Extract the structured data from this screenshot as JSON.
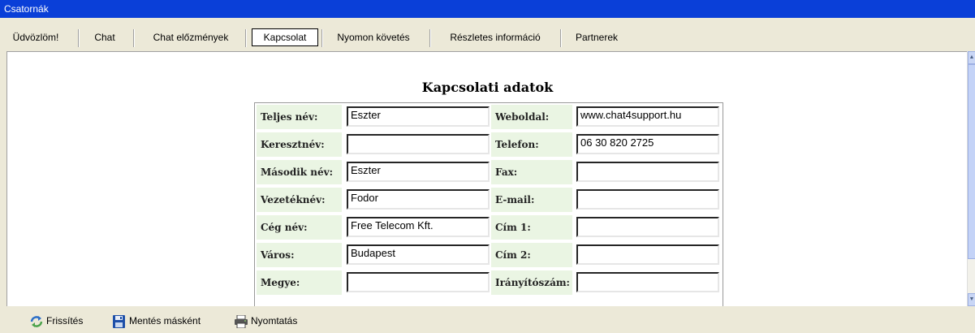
{
  "window": {
    "title": "Csatornák"
  },
  "tabs": [
    {
      "label": "Üdvözlöm!"
    },
    {
      "label": "Chat"
    },
    {
      "label": "Chat előzmények"
    },
    {
      "label": "Kapcsolat",
      "active": true
    },
    {
      "label": "Nyomon követés"
    },
    {
      "label": "Részletes információ"
    },
    {
      "label": "Partnerek"
    }
  ],
  "form": {
    "title": "Kapcsolati adatok",
    "left": [
      {
        "label": "Teljes név:",
        "value": "Eszter"
      },
      {
        "label": "Keresztnév:",
        "value": ""
      },
      {
        "label": "Második név:",
        "value": "Eszter"
      },
      {
        "label": "Vezetéknév:",
        "value": "Fodor"
      },
      {
        "label": "Cég név:",
        "value": "Free Telecom Kft."
      },
      {
        "label": "Város:",
        "value": "Budapest"
      },
      {
        "label": "Megye:",
        "value": ""
      }
    ],
    "right": [
      {
        "label": "Weboldal:",
        "value": "www.chat4support.hu"
      },
      {
        "label": "Telefon:",
        "value": "06 30 820 2725"
      },
      {
        "label": "Fax:",
        "value": ""
      },
      {
        "label": "E-mail:",
        "value": ""
      },
      {
        "label": "Cím 1:",
        "value": ""
      },
      {
        "label": "Cím 2:",
        "value": ""
      },
      {
        "label": "Irányítószám:",
        "value": ""
      }
    ]
  },
  "toolbar": {
    "refresh_label": "Frissítés",
    "save_as_label": "Mentés másként",
    "print_label": "Nyomtatás"
  }
}
